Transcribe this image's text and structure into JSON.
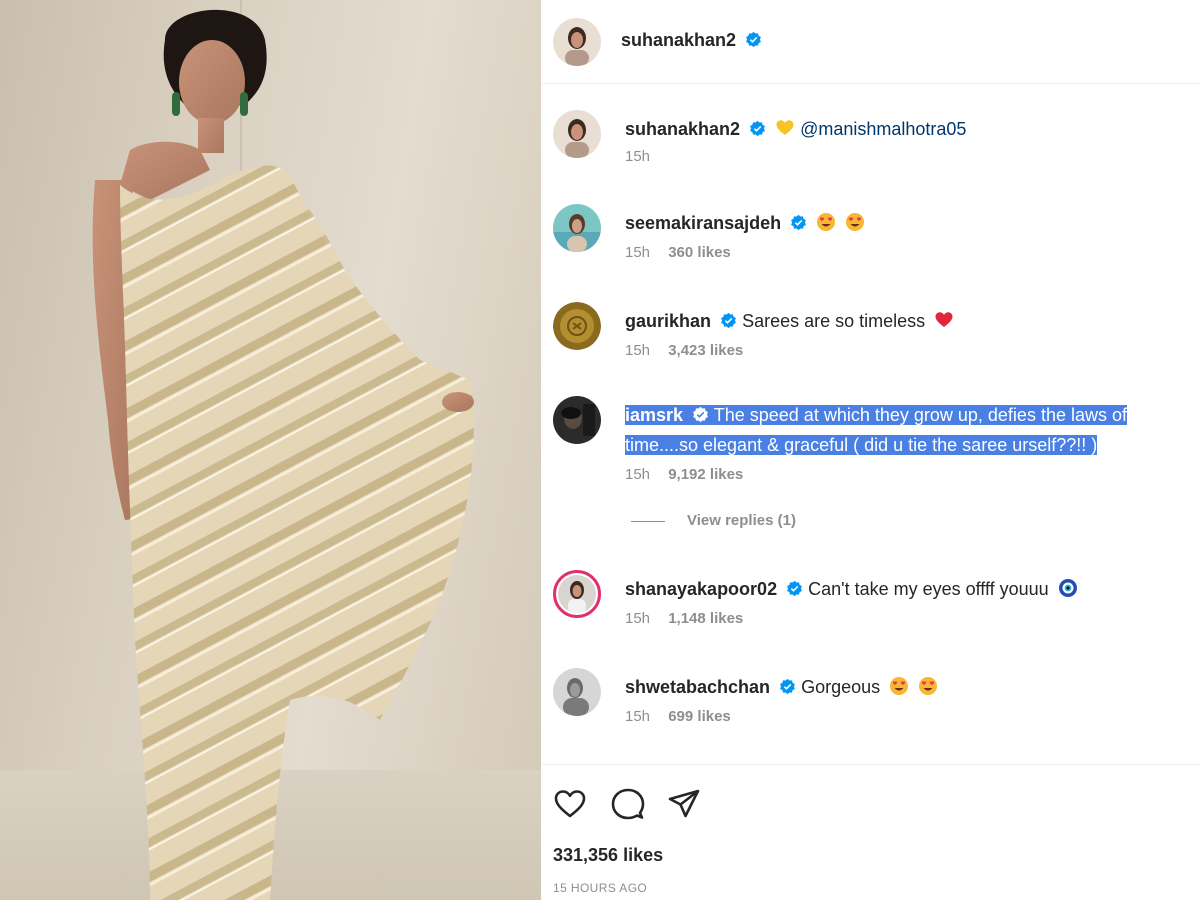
{
  "post": {
    "author": "suhanakhan2",
    "likes_text": "331,356 likes",
    "time_text": "15 HOURS AGO"
  },
  "comments": [
    {
      "username": "suhanakhan2",
      "text": "@manishmalhotra05",
      "emoji": [
        "yellow-heart"
      ],
      "time": "15h",
      "likes": ""
    },
    {
      "username": "seemakiransajdeh",
      "text": "",
      "emoji": [
        "heart-eyes",
        "heart-eyes"
      ],
      "time": "15h",
      "likes": "360 likes"
    },
    {
      "username": "gaurikhan",
      "text": "Sarees are so timeless",
      "emoji": [
        "red-heart"
      ],
      "time": "15h",
      "likes": "3,423 likes"
    },
    {
      "username": "iamsrk",
      "text": "The speed at which they grow up, defies the laws of time....so elegant & graceful ( did u tie the saree urself??!! )",
      "emoji": [],
      "time": "15h",
      "likes": "9,192 likes",
      "highlighted": true
    },
    {
      "username": "shanayakapoor02",
      "text": "Can't take my eyes offff youuu",
      "emoji": [
        "nazar-amulet"
      ],
      "time": "15h",
      "likes": "1,148 likes"
    },
    {
      "username": "shwetabachchan",
      "text": "Gorgeous",
      "emoji": [
        "heart-eyes",
        "heart-eyes"
      ],
      "time": "15h",
      "likes": "699 likes"
    }
  ],
  "view_replies": "View replies (1)",
  "icons": {
    "verified": "verified-badge-icon",
    "like": "heart-outline-icon",
    "comment": "speech-bubble-icon",
    "share": "paper-plane-icon"
  },
  "colors": {
    "verified": "#0095f6",
    "highlight": "#4a7fe3",
    "secondary_text": "#8e8e8e",
    "mention": "#00376b"
  }
}
